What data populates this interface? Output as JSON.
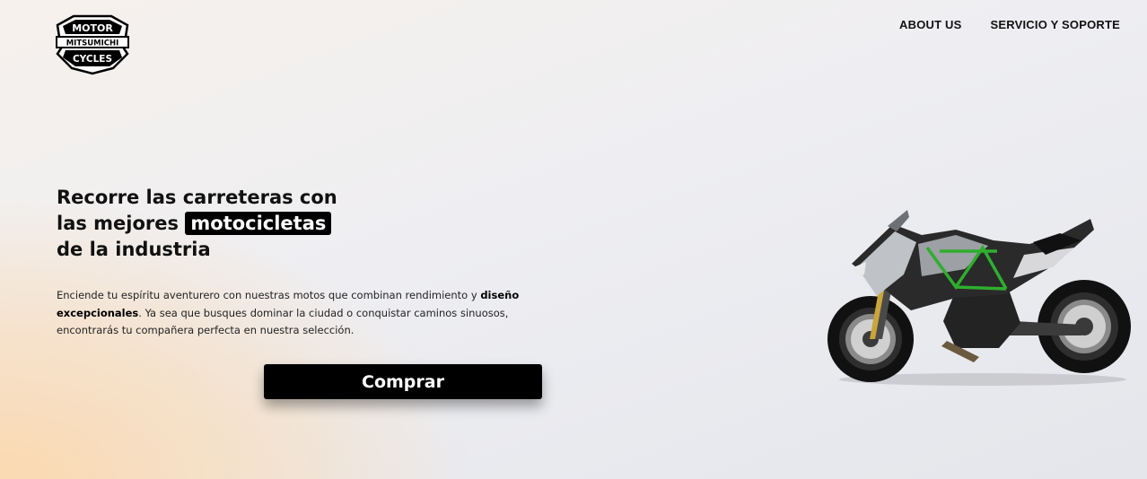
{
  "brand": {
    "logo_top": "MOTOR",
    "logo_middle": "MITSUMICHI",
    "logo_bottom": "CYCLES"
  },
  "nav": {
    "items": [
      {
        "label": "ABOUT US"
      },
      {
        "label": "SERVICIO Y SOPORTE"
      }
    ]
  },
  "hero": {
    "headline_part1": "Recorre las carreteras con las mejores",
    "headline_highlight": "motocicletas",
    "headline_part2": "de la industria",
    "description_part1": "Enciende tu espíritu aventurero con nuestras motos que combinan rendimiento y",
    "description_bold": "diseño excepcionales",
    "description_part2": ". Ya sea que busques dominar la ciudad o conquistar caminos sinuosos, encontrarás tu compañera perfecta en nuestra selección.",
    "cta_label": "Comprar"
  },
  "colors": {
    "accent": "#000000",
    "warm_glow": "#fbd9b0",
    "frame_green": "#2fae2f"
  },
  "icons": {
    "logo": "motorcycle-shield-logo",
    "hero_image": "sport-motorcycle-image"
  }
}
